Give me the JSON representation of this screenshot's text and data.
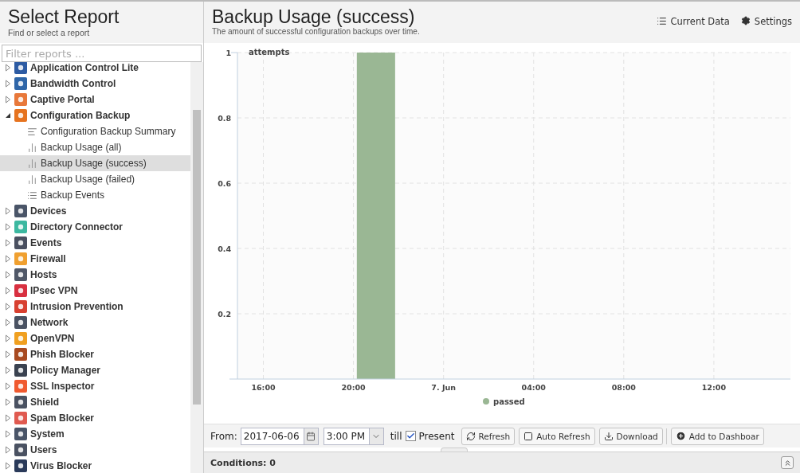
{
  "sidebar": {
    "title": "Select Report",
    "subtitle": "Find or select a report",
    "filter": {
      "placeholder": "Filter reports ..."
    },
    "tree": [
      {
        "label": "Application Control Lite",
        "color": "#2d5ba3",
        "expanded": false,
        "selected": false
      },
      {
        "label": "Bandwidth Control",
        "color": "#2f66a8",
        "expanded": false,
        "selected": false
      },
      {
        "label": "Captive Portal",
        "color": "#e8783a",
        "expanded": false,
        "selected": false
      },
      {
        "label": "Configuration Backup",
        "color": "#e6731f",
        "expanded": true,
        "selected": false,
        "children": [
          {
            "label": "Configuration Backup Summary",
            "kind": "text",
            "selected": false
          },
          {
            "label": "Backup Usage (all)",
            "kind": "chart",
            "selected": false
          },
          {
            "label": "Backup Usage (success)",
            "kind": "chart",
            "selected": true
          },
          {
            "label": "Backup Usage (failed)",
            "kind": "chart",
            "selected": false
          },
          {
            "label": "Backup Events",
            "kind": "events",
            "selected": false
          }
        ]
      },
      {
        "label": "Devices",
        "color": "#4a5568",
        "expanded": false,
        "selected": false
      },
      {
        "label": "Directory Connector",
        "color": "#3cb8a0",
        "expanded": false,
        "selected": false
      },
      {
        "label": "Events",
        "color": "#4a5060",
        "expanded": false,
        "selected": false
      },
      {
        "label": "Firewall",
        "color": "#f0a030",
        "expanded": false,
        "selected": false
      },
      {
        "label": "Hosts",
        "color": "#505868",
        "expanded": false,
        "selected": false
      },
      {
        "label": "IPsec VPN",
        "color": "#d83040",
        "expanded": false,
        "selected": false
      },
      {
        "label": "Intrusion Prevention",
        "color": "#d84030",
        "expanded": false,
        "selected": false
      },
      {
        "label": "Network",
        "color": "#4a5262",
        "expanded": false,
        "selected": false
      },
      {
        "label": "OpenVPN",
        "color": "#f0a020",
        "expanded": false,
        "selected": false
      },
      {
        "label": "Phish Blocker",
        "color": "#a84a20",
        "expanded": false,
        "selected": false
      },
      {
        "label": "Policy Manager",
        "color": "#3a4250",
        "expanded": false,
        "selected": false
      },
      {
        "label": "SSL Inspector",
        "color": "#f05a30",
        "expanded": false,
        "selected": false
      },
      {
        "label": "Shield",
        "color": "#4a5262",
        "expanded": false,
        "selected": false
      },
      {
        "label": "Spam Blocker",
        "color": "#e05a50",
        "expanded": false,
        "selected": false
      },
      {
        "label": "System",
        "color": "#4a5568",
        "expanded": false,
        "selected": false
      },
      {
        "label": "Users",
        "color": "#4a5262",
        "expanded": false,
        "selected": false
      },
      {
        "label": "Virus Blocker",
        "color": "#2a3a5a",
        "expanded": false,
        "selected": false
      }
    ]
  },
  "report": {
    "title": "Backup Usage (success)",
    "description": "The amount of successful configuration backups over time.",
    "actions": [
      {
        "label": "Current Data",
        "kind": "data"
      },
      {
        "label": "Settings",
        "kind": "settings"
      }
    ],
    "chart_data": {
      "type": "bar",
      "ylabel": "attempts",
      "grid": true,
      "x": [
        "2017-06-06 21:00"
      ],
      "series": [
        {
          "name": "passed",
          "color": "#9ab794",
          "values": [
            1
          ]
        }
      ],
      "xlim": [
        "2017-06-06 14:51",
        "2017-06-07 15:24"
      ],
      "ylim": [
        0,
        1
      ],
      "xticks": [
        {
          "value": "2017-06-06 16:00",
          "label": "16:00"
        },
        {
          "value": "2017-06-06 20:00",
          "label": "20:00"
        },
        {
          "value": "2017-06-07 00:00",
          "label": "7. Jun"
        },
        {
          "value": "2017-06-07 04:00",
          "label": "04:00"
        },
        {
          "value": "2017-06-07 08:00",
          "label": "08:00"
        },
        {
          "value": "2017-06-07 12:00",
          "label": "12:00"
        }
      ],
      "yticks": [
        0.2,
        0.4,
        0.6,
        0.8,
        1
      ]
    }
  },
  "toolbar": {
    "from_label": "From:",
    "date": "2017-06-06",
    "time": "3:00 PM",
    "till_label": "till",
    "present": {
      "label": "Present",
      "checked": true
    },
    "buttons": [
      {
        "label": "Refresh",
        "kind": "refresh"
      },
      {
        "label": "Auto Refresh",
        "kind": "toggle",
        "on": false
      },
      {
        "label": "Download",
        "kind": "download"
      },
      {
        "label": "Add to Dashboar",
        "kind": "add"
      }
    ]
  },
  "conditions": {
    "label": "Conditions: 0"
  }
}
